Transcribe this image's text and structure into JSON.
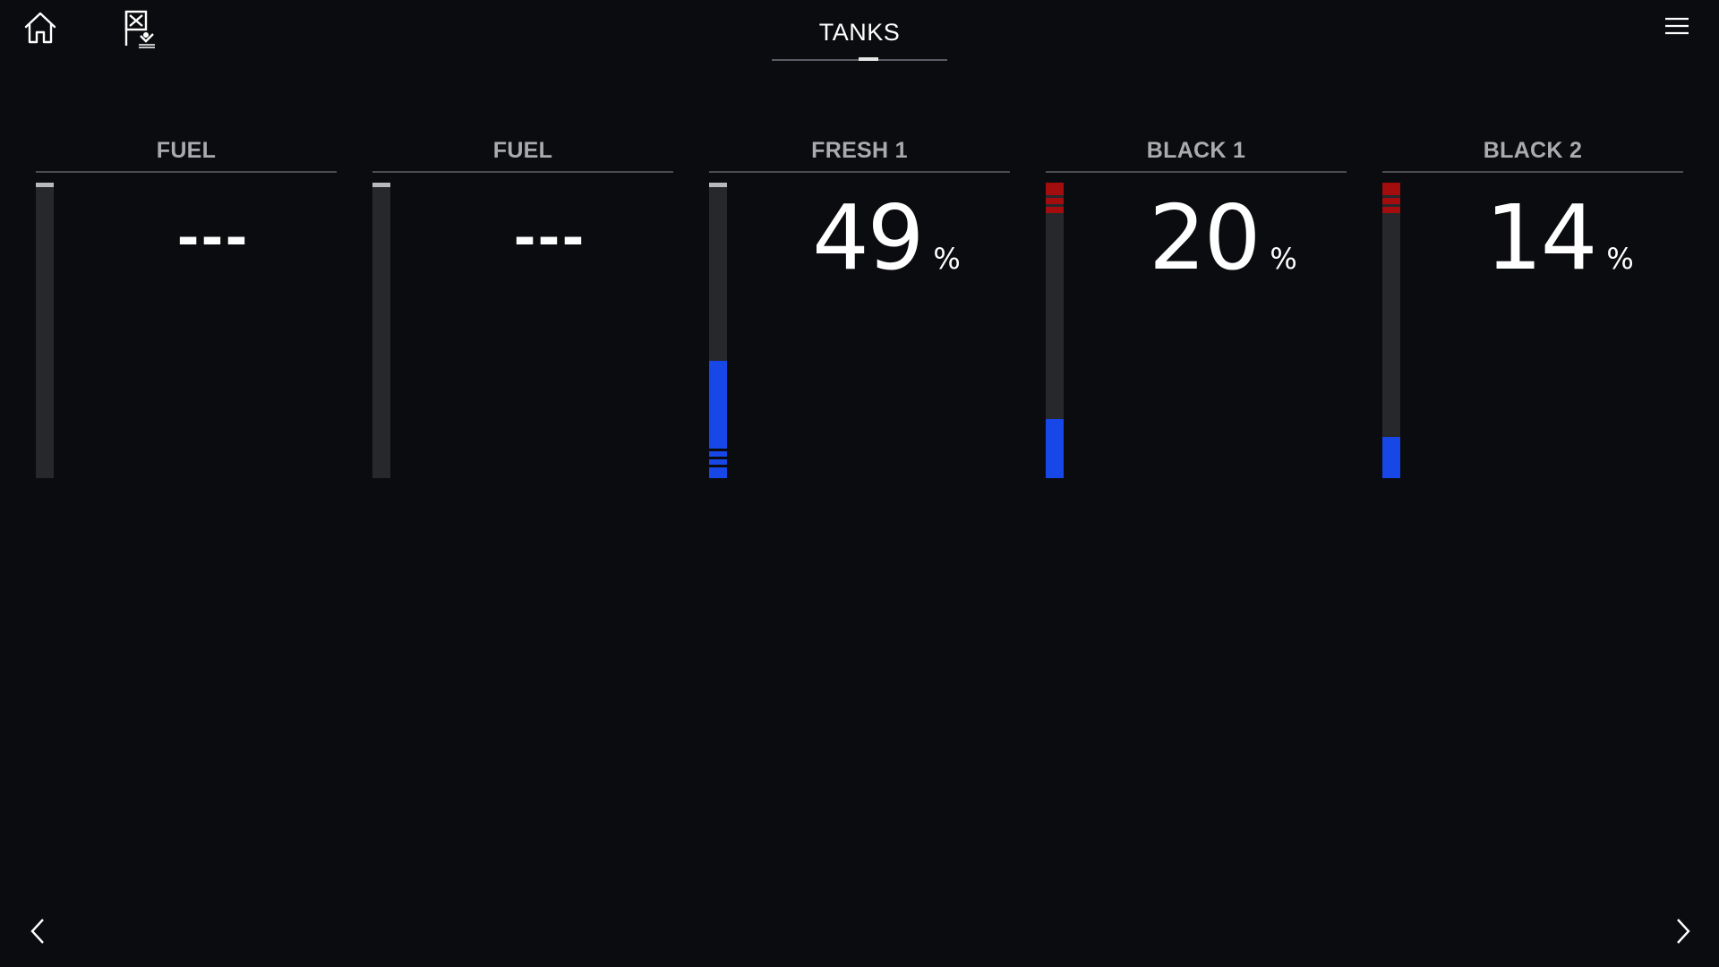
{
  "header": {
    "title": "TANKS",
    "icons": {
      "home": "home-icon",
      "mob": "man-overboard-icon",
      "menu": "hamburger-menu-icon"
    }
  },
  "tanks": [
    {
      "label": "FUEL",
      "value": "---",
      "unit": "",
      "level_percent": null,
      "alarm": false
    },
    {
      "label": "FUEL",
      "value": "---",
      "unit": "",
      "level_percent": null,
      "alarm": false
    },
    {
      "label": "FRESH 1",
      "value": "49",
      "unit": "%",
      "level_percent": 49,
      "alarm": false
    },
    {
      "label": "BLACK 1",
      "value": "20",
      "unit": "%",
      "level_percent": 20,
      "alarm": true
    },
    {
      "label": "BLACK 2",
      "value": "14",
      "unit": "%",
      "level_percent": 14,
      "alarm": true
    }
  ],
  "navigation": {
    "prev_icon": "chevron-left-icon",
    "next_icon": "chevron-right-icon"
  },
  "colors": {
    "background": "#0b0c0f",
    "fill": "#1747e6",
    "alarm": "#a30d0d",
    "track": "#26282c",
    "label": "#a9abae"
  }
}
